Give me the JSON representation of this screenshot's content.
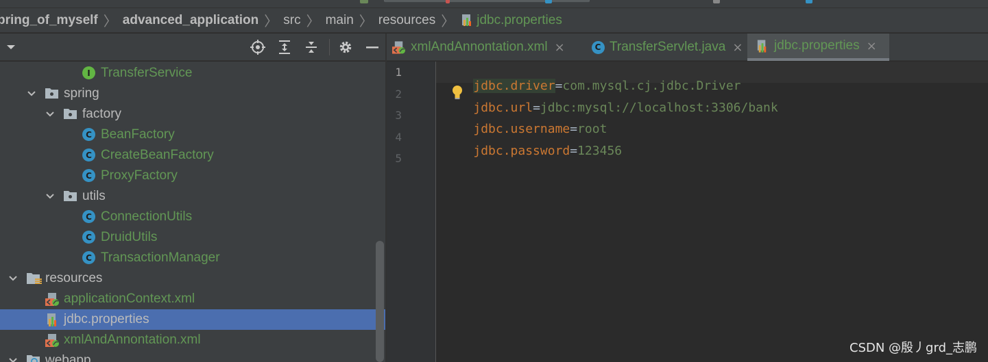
{
  "breadcrumb": {
    "items": [
      "pring_of_myself",
      "advanced_application",
      "src",
      "main",
      "resources",
      "jdbc.properties"
    ]
  },
  "project_tree": {
    "rows": [
      {
        "label": "TransferService",
        "kind": "interface"
      },
      {
        "label": "spring",
        "kind": "package"
      },
      {
        "label": "factory",
        "kind": "package"
      },
      {
        "label": "BeanFactory",
        "kind": "class"
      },
      {
        "label": "CreateBeanFactory",
        "kind": "class"
      },
      {
        "label": "ProxyFactory",
        "kind": "class"
      },
      {
        "label": "utils",
        "kind": "package"
      },
      {
        "label": "ConnectionUtils",
        "kind": "class"
      },
      {
        "label": "DruidUtils",
        "kind": "class"
      },
      {
        "label": "TransactionManager",
        "kind": "class"
      },
      {
        "label": "resources",
        "kind": "resources-folder"
      },
      {
        "label": "applicationContext.xml",
        "kind": "xml"
      },
      {
        "label": "jdbc.properties",
        "kind": "properties",
        "selected": true
      },
      {
        "label": "xmlAndAnnontation.xml",
        "kind": "xml"
      },
      {
        "label": "webapp",
        "kind": "web-folder"
      }
    ]
  },
  "tabs": [
    {
      "label": "xmlAndAnnontation.xml",
      "kind": "xml",
      "close": "×"
    },
    {
      "label": "TransferServlet.java",
      "kind": "class",
      "close": "×"
    },
    {
      "label": "jdbc.properties",
      "kind": "properties",
      "close": "×",
      "active": true
    }
  ],
  "editor": {
    "line_numbers": [
      "1",
      "2",
      "3",
      "4",
      "5"
    ],
    "lines": [
      {
        "key": "jdbc.driver",
        "eq": "=",
        "value": "com.mysql.cj.jdbc.Driver"
      },
      {
        "key": "jdbc.url",
        "eq": "=",
        "value": "jdbc:mysql://localhost:3306/bank"
      },
      {
        "key": "jdbc.username",
        "eq": "=",
        "value": "root"
      },
      {
        "key": "jdbc.password",
        "eq": "=",
        "value": "123456"
      }
    ]
  },
  "watermark": "CSDN @殷丿grd_志鹏",
  "icons": {
    "class": "C",
    "interface": "I",
    "toolbar": [
      "dropdown-icon",
      "locate-icon",
      "expand-all-icon",
      "collapse-all-icon",
      "gear-icon",
      "minimize-icon"
    ]
  },
  "colors": {
    "panel_bg": "#3c3f41",
    "editor_bg": "#2b2b2b",
    "selection": "#4b6eaf",
    "file_green": "#629755",
    "prop_key": "#cc7832",
    "prop_value": "#6a8759",
    "class_icon": "#3592c4",
    "interface_icon": "#62b543"
  }
}
